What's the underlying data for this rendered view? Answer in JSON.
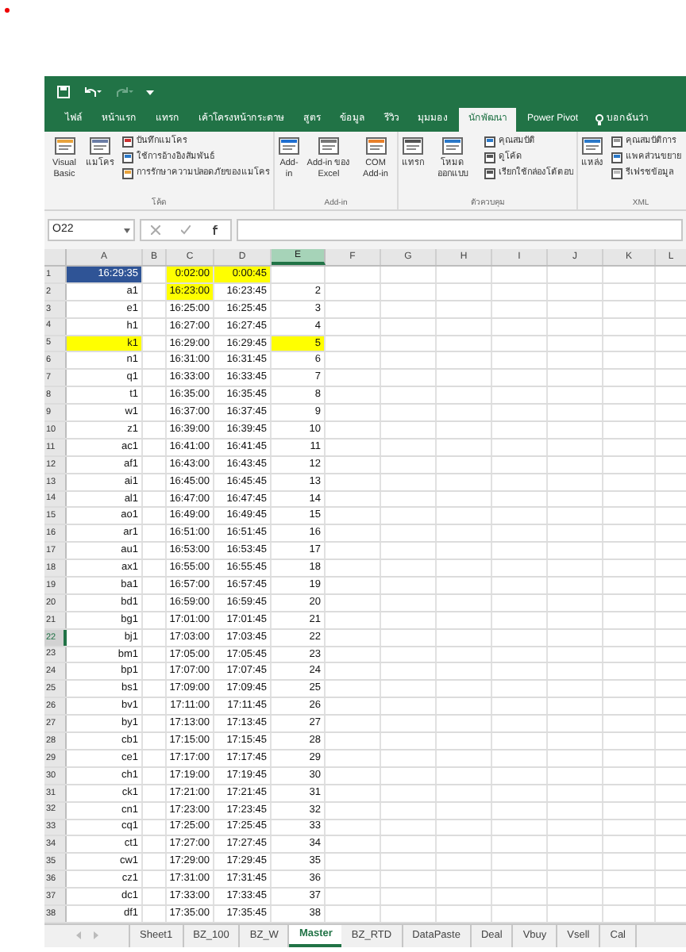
{
  "ribbon_tabs": [
    {
      "label": "ไฟล์",
      "selected": false
    },
    {
      "label": "หน้าแรก",
      "selected": false
    },
    {
      "label": "แทรก",
      "selected": false
    },
    {
      "label": "เค้าโครงหน้ากระดาษ",
      "selected": false
    },
    {
      "label": "สูตร",
      "selected": false
    },
    {
      "label": "ข้อมูล",
      "selected": false
    },
    {
      "label": "รีวิว",
      "selected": false
    },
    {
      "label": "มุมมอง",
      "selected": false
    },
    {
      "label": "นักพัฒนา",
      "selected": true
    },
    {
      "label": "Power Pivot",
      "selected": false
    }
  ],
  "tell_me": "บอกฉันว่า",
  "ribbon_groups": [
    {
      "label": "โค้ด",
      "items": [
        {
          "kind": "large",
          "label": "Visual Basic"
        },
        {
          "kind": "large",
          "label": "แมโคร"
        },
        {
          "kind": "small",
          "label": "บันทึกแมโคร"
        },
        {
          "kind": "small",
          "label": "ใช้การอ้างอิงสัมพันธ์"
        },
        {
          "kind": "small",
          "label": "การรักษาความปลอดภัยของแมโคร"
        }
      ]
    },
    {
      "label": "Add-in",
      "items": [
        {
          "kind": "large",
          "label": "Add-in"
        },
        {
          "kind": "large",
          "label": "Add-in ของ Excel"
        },
        {
          "kind": "large",
          "label": "COM Add-in"
        }
      ]
    },
    {
      "label": "ตัวควบคุม",
      "items": [
        {
          "kind": "large",
          "label": "แทรก"
        },
        {
          "kind": "large",
          "label": "โหมดออกแบบ"
        },
        {
          "kind": "small",
          "label": "คุณสมบัติ"
        },
        {
          "kind": "small",
          "label": "ดูโค้ด"
        },
        {
          "kind": "small",
          "label": "เรียกใช้กล่องโต้ตอบ"
        }
      ]
    },
    {
      "label": "XML",
      "items": [
        {
          "kind": "large",
          "label": "แหล่ง"
        },
        {
          "kind": "small",
          "label": "คุณสมบัติการ"
        },
        {
          "kind": "small",
          "label": "แพคส่วนขยาย"
        },
        {
          "kind": "small",
          "label": "รีเฟรชข้อมูล"
        }
      ]
    }
  ],
  "name_box": "O22",
  "columns": [
    {
      "label": "A",
      "selected": false
    },
    {
      "label": "B",
      "selected": false
    },
    {
      "label": "C",
      "selected": false
    },
    {
      "label": "D",
      "selected": false
    },
    {
      "label": "E",
      "selected": true
    },
    {
      "label": "F",
      "selected": false
    },
    {
      "label": "G",
      "selected": false
    },
    {
      "label": "H",
      "selected": false
    },
    {
      "label": "I",
      "selected": false
    },
    {
      "label": "J",
      "selected": false
    },
    {
      "label": "K",
      "selected": false
    },
    {
      "label": "L",
      "selected": false
    }
  ],
  "rows": [
    {
      "number": "1",
      "selected": false,
      "A": {
        "text": "16:29:35",
        "color": "#2f5496"
      },
      "C": {
        "text": "0:02:00",
        "color": "#ffff00"
      },
      "D": {
        "text": "0:00:45",
        "color": "#ffff00"
      }
    },
    {
      "number": "2",
      "selected": false,
      "A": {
        "text": "a1"
      },
      "C": {
        "text": "16:23:00",
        "color": "#ffff00"
      },
      "D": {
        "text": "16:23:45"
      },
      "E": {
        "text": "2"
      }
    },
    {
      "number": "3",
      "selected": false,
      "A": {
        "text": "e1"
      },
      "C": {
        "text": "16:25:00"
      },
      "D": {
        "text": "16:25:45"
      },
      "E": {
        "text": "3"
      }
    },
    {
      "number": "4",
      "selected": false,
      "A": {
        "text": "h1"
      },
      "C": {
        "text": "16:27:00"
      },
      "D": {
        "text": "16:27:45"
      },
      "E": {
        "text": "4"
      }
    },
    {
      "number": "5",
      "selected": false,
      "A": {
        "text": "k1",
        "color": "#ffff00"
      },
      "C": {
        "text": "16:29:00"
      },
      "D": {
        "text": "16:29:45"
      },
      "E": {
        "text": "5",
        "color": "#ffff00"
      }
    },
    {
      "number": "6",
      "selected": false,
      "A": {
        "text": "n1"
      },
      "C": {
        "text": "16:31:00"
      },
      "D": {
        "text": "16:31:45"
      },
      "E": {
        "text": "6"
      }
    },
    {
      "number": "7",
      "selected": false,
      "A": {
        "text": "q1"
      },
      "C": {
        "text": "16:33:00"
      },
      "D": {
        "text": "16:33:45"
      },
      "E": {
        "text": "7"
      }
    },
    {
      "number": "8",
      "selected": false,
      "A": {
        "text": "t1"
      },
      "C": {
        "text": "16:35:00"
      },
      "D": {
        "text": "16:35:45"
      },
      "E": {
        "text": "8"
      }
    },
    {
      "number": "9",
      "selected": false,
      "A": {
        "text": "w1"
      },
      "C": {
        "text": "16:37:00"
      },
      "D": {
        "text": "16:37:45"
      },
      "E": {
        "text": "9"
      }
    },
    {
      "number": "10",
      "selected": false,
      "A": {
        "text": "z1"
      },
      "C": {
        "text": "16:39:00"
      },
      "D": {
        "text": "16:39:45"
      },
      "E": {
        "text": "10"
      }
    },
    {
      "number": "11",
      "selected": false,
      "A": {
        "text": "ac1"
      },
      "C": {
        "text": "16:41:00"
      },
      "D": {
        "text": "16:41:45"
      },
      "E": {
        "text": "11"
      }
    },
    {
      "number": "12",
      "selected": false,
      "A": {
        "text": "af1"
      },
      "C": {
        "text": "16:43:00"
      },
      "D": {
        "text": "16:43:45"
      },
      "E": {
        "text": "12"
      }
    },
    {
      "number": "13",
      "selected": false,
      "A": {
        "text": "ai1"
      },
      "C": {
        "text": "16:45:00"
      },
      "D": {
        "text": "16:45:45"
      },
      "E": {
        "text": "13"
      }
    },
    {
      "number": "14",
      "selected": false,
      "A": {
        "text": "al1"
      },
      "C": {
        "text": "16:47:00"
      },
      "D": {
        "text": "16:47:45"
      },
      "E": {
        "text": "14"
      }
    },
    {
      "number": "15",
      "selected": false,
      "A": {
        "text": "ao1"
      },
      "C": {
        "text": "16:49:00"
      },
      "D": {
        "text": "16:49:45"
      },
      "E": {
        "text": "15"
      }
    },
    {
      "number": "16",
      "selected": false,
      "A": {
        "text": "ar1"
      },
      "C": {
        "text": "16:51:00"
      },
      "D": {
        "text": "16:51:45"
      },
      "E": {
        "text": "16"
      }
    },
    {
      "number": "17",
      "selected": false,
      "A": {
        "text": "au1"
      },
      "C": {
        "text": "16:53:00"
      },
      "D": {
        "text": "16:53:45"
      },
      "E": {
        "text": "17"
      }
    },
    {
      "number": "18",
      "selected": false,
      "A": {
        "text": "ax1"
      },
      "C": {
        "text": "16:55:00"
      },
      "D": {
        "text": "16:55:45"
      },
      "E": {
        "text": "18"
      }
    },
    {
      "number": "19",
      "selected": false,
      "A": {
        "text": "ba1"
      },
      "C": {
        "text": "16:57:00"
      },
      "D": {
        "text": "16:57:45"
      },
      "E": {
        "text": "19"
      }
    },
    {
      "number": "20",
      "selected": false,
      "A": {
        "text": "bd1"
      },
      "C": {
        "text": "16:59:00"
      },
      "D": {
        "text": "16:59:45"
      },
      "E": {
        "text": "20"
      }
    },
    {
      "number": "21",
      "selected": false,
      "A": {
        "text": "bg1"
      },
      "C": {
        "text": "17:01:00"
      },
      "D": {
        "text": "17:01:45"
      },
      "E": {
        "text": "21"
      }
    },
    {
      "number": "22",
      "selected": true,
      "A": {
        "text": "bj1"
      },
      "C": {
        "text": "17:03:00"
      },
      "D": {
        "text": "17:03:45"
      },
      "E": {
        "text": "22"
      }
    },
    {
      "number": "23",
      "selected": false,
      "A": {
        "text": "bm1"
      },
      "C": {
        "text": "17:05:00"
      },
      "D": {
        "text": "17:05:45"
      },
      "E": {
        "text": "23"
      }
    },
    {
      "number": "24",
      "selected": false,
      "A": {
        "text": "bp1"
      },
      "C": {
        "text": "17:07:00"
      },
      "D": {
        "text": "17:07:45"
      },
      "E": {
        "text": "24"
      }
    },
    {
      "number": "25",
      "selected": false,
      "A": {
        "text": "bs1"
      },
      "C": {
        "text": "17:09:00"
      },
      "D": {
        "text": "17:09:45"
      },
      "E": {
        "text": "25"
      }
    },
    {
      "number": "26",
      "selected": false,
      "A": {
        "text": "bv1"
      },
      "C": {
        "text": "17:11:00"
      },
      "D": {
        "text": "17:11:45"
      },
      "E": {
        "text": "26"
      }
    },
    {
      "number": "27",
      "selected": false,
      "A": {
        "text": "by1"
      },
      "C": {
        "text": "17:13:00"
      },
      "D": {
        "text": "17:13:45"
      },
      "E": {
        "text": "27"
      }
    },
    {
      "number": "28",
      "selected": false,
      "A": {
        "text": "cb1"
      },
      "C": {
        "text": "17:15:00"
      },
      "D": {
        "text": "17:15:45"
      },
      "E": {
        "text": "28"
      }
    },
    {
      "number": "29",
      "selected": false,
      "A": {
        "text": "ce1"
      },
      "C": {
        "text": "17:17:00"
      },
      "D": {
        "text": "17:17:45"
      },
      "E": {
        "text": "29"
      }
    },
    {
      "number": "30",
      "selected": false,
      "A": {
        "text": "ch1"
      },
      "C": {
        "text": "17:19:00"
      },
      "D": {
        "text": "17:19:45"
      },
      "E": {
        "text": "30"
      }
    },
    {
      "number": "31",
      "selected": false,
      "A": {
        "text": "ck1"
      },
      "C": {
        "text": "17:21:00"
      },
      "D": {
        "text": "17:21:45"
      },
      "E": {
        "text": "31"
      }
    },
    {
      "number": "32",
      "selected": false,
      "A": {
        "text": "cn1"
      },
      "C": {
        "text": "17:23:00"
      },
      "D": {
        "text": "17:23:45"
      },
      "E": {
        "text": "32"
      }
    },
    {
      "number": "33",
      "selected": false,
      "A": {
        "text": "cq1"
      },
      "C": {
        "text": "17:25:00"
      },
      "D": {
        "text": "17:25:45"
      },
      "E": {
        "text": "33"
      }
    },
    {
      "number": "34",
      "selected": false,
      "A": {
        "text": "ct1"
      },
      "C": {
        "text": "17:27:00"
      },
      "D": {
        "text": "17:27:45"
      },
      "E": {
        "text": "34"
      }
    },
    {
      "number": "35",
      "selected": false,
      "A": {
        "text": "cw1"
      },
      "C": {
        "text": "17:29:00"
      },
      "D": {
        "text": "17:29:45"
      },
      "E": {
        "text": "35"
      }
    },
    {
      "number": "36",
      "selected": false,
      "A": {
        "text": "cz1"
      },
      "C": {
        "text": "17:31:00"
      },
      "D": {
        "text": "17:31:45"
      },
      "E": {
        "text": "36"
      }
    },
    {
      "number": "37",
      "selected": false,
      "A": {
        "text": "dc1"
      },
      "C": {
        "text": "17:33:00"
      },
      "D": {
        "text": "17:33:45"
      },
      "E": {
        "text": "37"
      }
    },
    {
      "number": "38",
      "selected": false,
      "A": {
        "text": "df1"
      },
      "C": {
        "text": "17:35:00"
      },
      "D": {
        "text": "17:35:45"
      },
      "E": {
        "text": "38"
      }
    }
  ],
  "sheet_tabs": [
    {
      "label": "Sheet1",
      "selected": false
    },
    {
      "label": "BZ_100",
      "selected": false
    },
    {
      "label": "BZ_W",
      "selected": false
    },
    {
      "label": "Master",
      "selected": true
    },
    {
      "label": "BZ_RTD",
      "selected": false
    },
    {
      "label": "DataPaste",
      "selected": false
    },
    {
      "label": "Deal",
      "selected": false
    },
    {
      "label": "Vbuy",
      "selected": false
    },
    {
      "label": "Vsell",
      "selected": false
    },
    {
      "label": "Cal",
      "selected": false
    }
  ]
}
